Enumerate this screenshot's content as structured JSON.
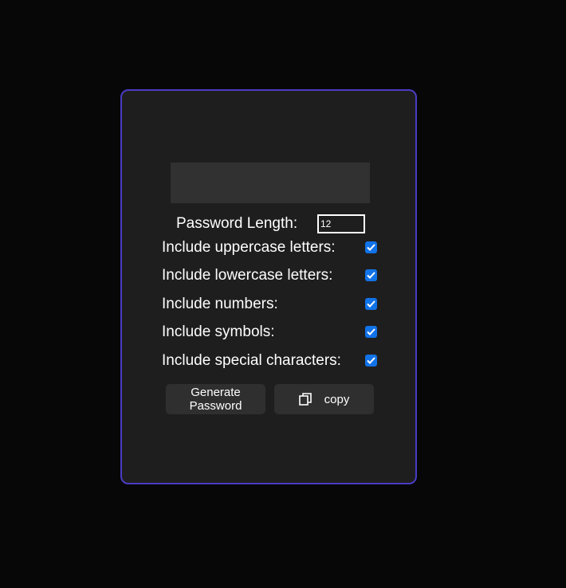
{
  "output": {
    "value": ""
  },
  "length": {
    "label": "Password Length:",
    "value": "12"
  },
  "options": [
    {
      "label": "Include uppercase letters:",
      "checked": true
    },
    {
      "label": "Include lowercase letters:",
      "checked": true
    },
    {
      "label": "Include numbers:",
      "checked": true
    },
    {
      "label": "Include symbols:",
      "checked": true
    },
    {
      "label": "Include special characters:",
      "checked": true
    }
  ],
  "buttons": {
    "generate_label": "Generate Password",
    "copy_label": "copy",
    "copy_icon": "copy-icon"
  },
  "colors": {
    "accent_border": "#4a3cc4",
    "checkbox": "#1173e8",
    "card_bg": "#1f1e1f",
    "page_bg": "#070707"
  }
}
